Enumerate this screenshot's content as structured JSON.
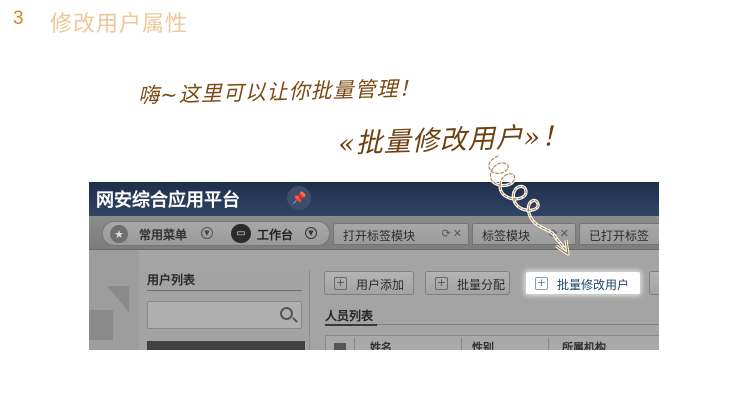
{
  "slide": {
    "step_number": "3",
    "title": "修改用户属性"
  },
  "annotations": {
    "note_line1": "嗨~这里可以让你批量管理！",
    "note_line2": "«批量修改用户»！"
  },
  "app": {
    "brand_title": "网安综合应用平台",
    "nav": {
      "common_menu": "常用菜单",
      "workbench": "工作台"
    },
    "tabs": [
      {
        "label": "打开标签模块"
      },
      {
        "label": "标签模块"
      },
      {
        "label": "已打开标签"
      }
    ],
    "user_panel": {
      "title": "用户列表",
      "search_placeholder": ""
    },
    "toolbar": {
      "add_user": "用户添加",
      "batch_assign": "批量分配",
      "batch_modify": "批量修改用户"
    },
    "staff_list": {
      "title": "人员列表",
      "columns": [
        "姓名",
        "性别",
        "所属机构"
      ]
    }
  },
  "colors": {
    "step_number": "#d9862a",
    "title": "#ecc89a",
    "handwriting": "#7a4a12",
    "topbar": "#26385a"
  }
}
